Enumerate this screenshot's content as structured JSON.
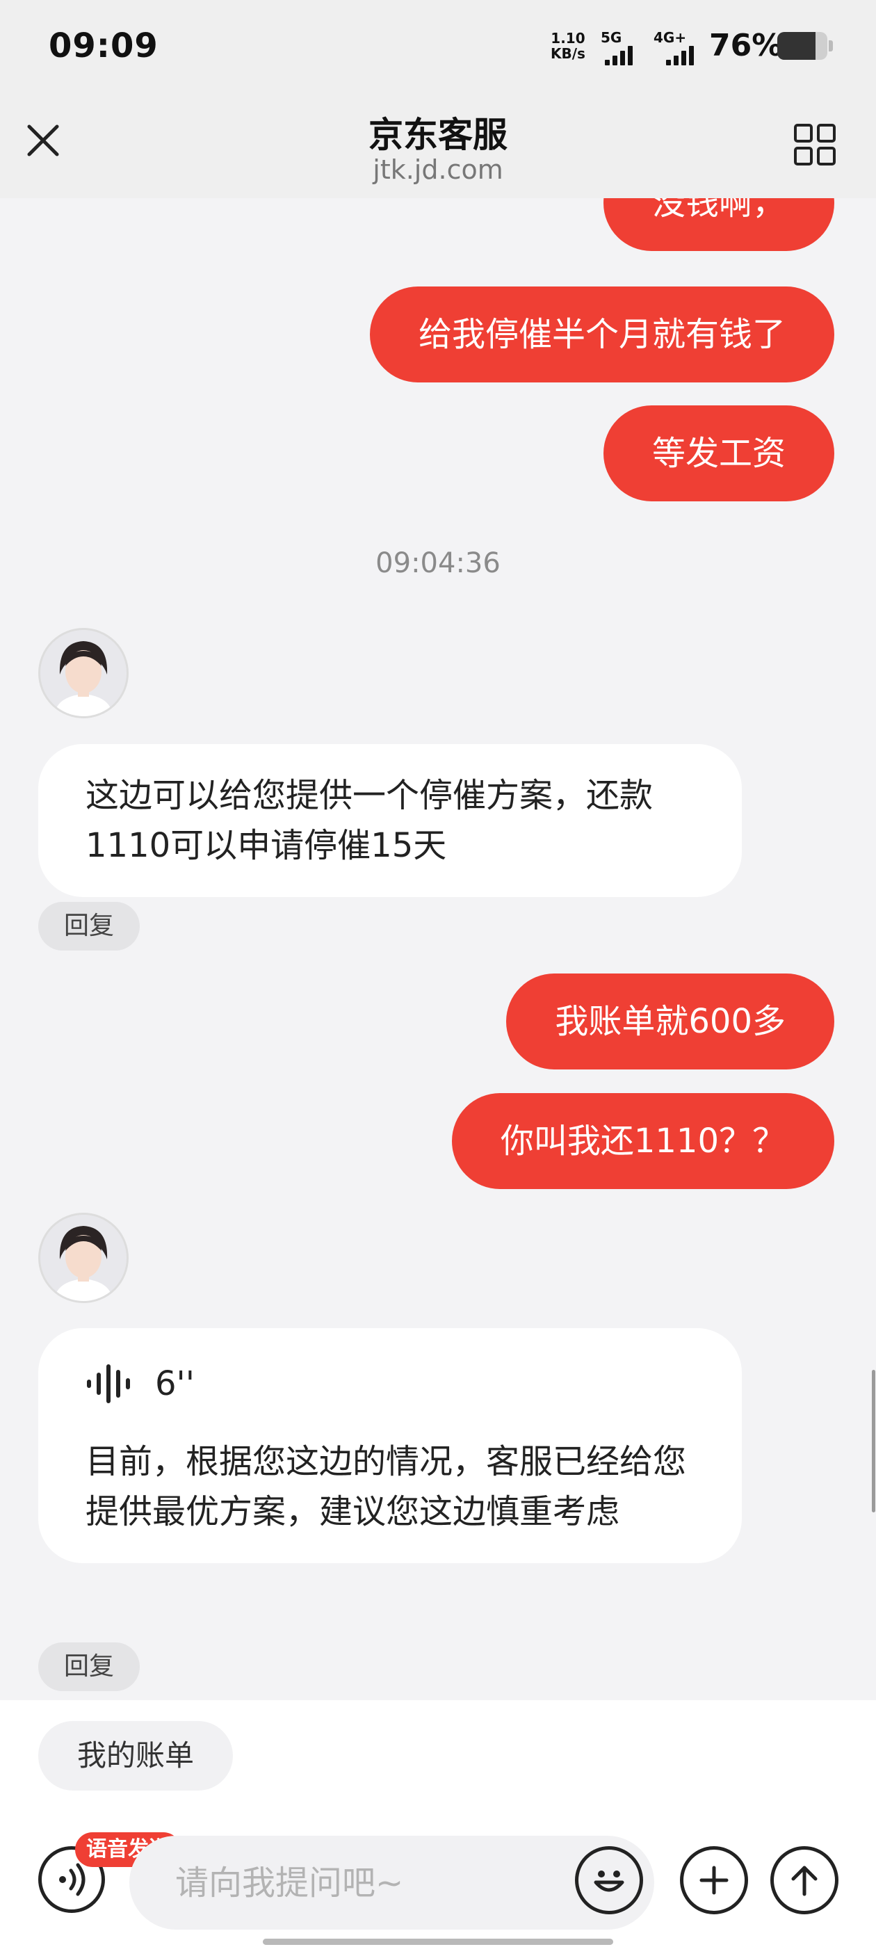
{
  "status_bar": {
    "time": "09:09",
    "net_speed_value": "1.10",
    "net_speed_unit": "KB/s",
    "signal1_label": "5G",
    "signal2_label": "4G+",
    "battery_percent": "76%",
    "battery_level": 0.76
  },
  "header": {
    "title": "京东客服",
    "subtitle": "jtk.jd.com",
    "close_icon": "close-icon",
    "menu_icon": "grid-icon"
  },
  "messages": [
    {
      "sender": "me",
      "text": "没钱啊，"
    },
    {
      "sender": "me",
      "text": "给我停催半个月就有钱了"
    },
    {
      "sender": "me",
      "text": "等发工资"
    },
    {
      "type": "timestamp",
      "text": "09:04:36"
    },
    {
      "sender": "agent",
      "text": "这边可以给您提供一个停催方案，还款1110可以申请停催15天",
      "reply_label": "回复"
    },
    {
      "sender": "me",
      "text": "我账单就600多"
    },
    {
      "sender": "me",
      "text": "你叫我还1110？？"
    },
    {
      "sender": "agent",
      "voice_duration": "6''",
      "text": "目前，根据您这边的情况，客服已经给您提供最优方案，建议您这边慎重考虑",
      "reply_label": "回复"
    }
  ],
  "quick_actions": {
    "bill_label": "我的账单"
  },
  "input_bar": {
    "voice_badge": "语音发送",
    "placeholder": "请向我提问吧~",
    "icons": [
      "voice-icon",
      "emoji-icon",
      "plus-icon",
      "send-arrow-icon"
    ]
  },
  "colors": {
    "accent_red": "#ef3f34",
    "background": "#f3f3f5",
    "bubble_agent": "#ffffff"
  }
}
